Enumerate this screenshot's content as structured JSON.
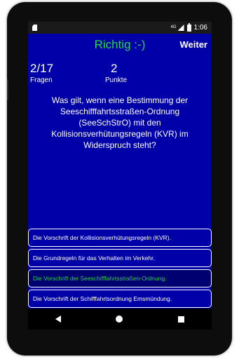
{
  "status_bar": {
    "network": "4G",
    "time": "1:06",
    "icons": [
      "sd-card-icon",
      "signal-icon",
      "battery-icon"
    ]
  },
  "header": {
    "result": "Richtig :-)",
    "next_label": "Weiter"
  },
  "stats": {
    "questions_value": "2/17",
    "questions_label": "Fragen",
    "points_value": "2",
    "points_label": "Punkte"
  },
  "question": "Was gilt, wenn eine Bestimmung der Seeschifffahrtsstraßen-Ordnung (SeeSchStrO) mit den Kollisionsverhütungsregeln (KVR) im Widerspruch steht?",
  "answers": [
    {
      "text": "Die Vorschrift der Kollisionsverhütungsregeln (KVR).",
      "correct": false
    },
    {
      "text": "Die Grundregeln für das Verhalten im Verkehr.",
      "correct": false
    },
    {
      "text": "Die Vorschrift der Seeschifffahrtsstraßen-Ordnung.",
      "correct": true
    },
    {
      "text": "Die Vorschrift der Schifffahrtsordnung Emsmündung.",
      "correct": false
    }
  ],
  "colors": {
    "background": "#0000a8",
    "correct_green": "#22d640",
    "selected_answer_bg": "#000070",
    "text": "#ffffff"
  },
  "nav_bar": {
    "icons": [
      "back-icon",
      "home-icon",
      "recent-apps-icon"
    ]
  }
}
